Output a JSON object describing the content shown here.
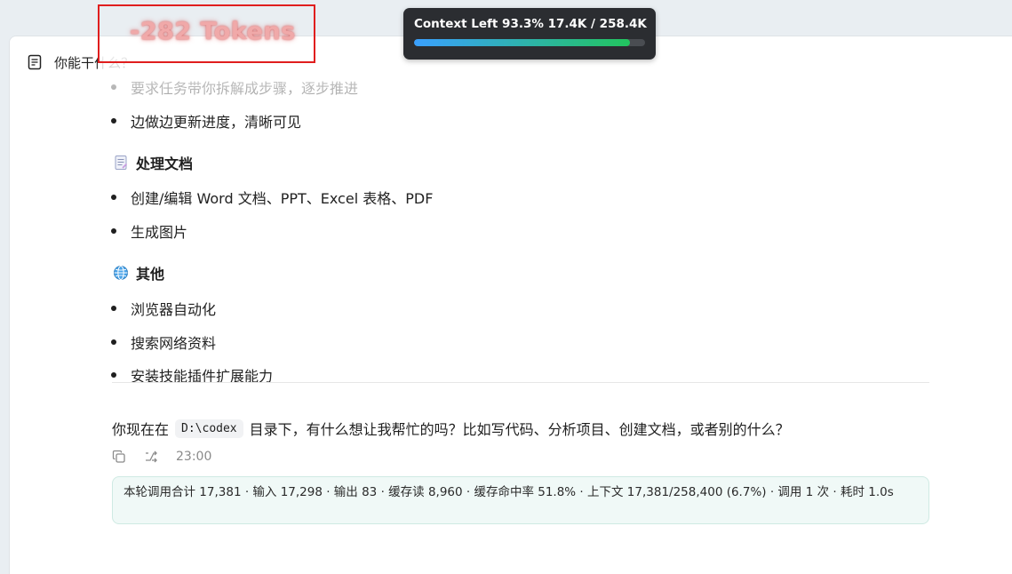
{
  "header": {
    "title": "你能干什么？"
  },
  "content": {
    "faded_item": "要求任务带你拆解成步骤，逐步推进",
    "item_progress": "边做边更新进度，清晰可见",
    "section_docs": "处理文档",
    "docs_items": [
      "创建/编辑 Word 文档、PPT、Excel 表格、PDF",
      "生成图片"
    ],
    "section_other": "其他",
    "other_items": [
      "浏览器自动化",
      "搜索网络资料",
      "安装技能插件扩展能力"
    ]
  },
  "reply": {
    "prefix": "你现在在",
    "code": "D:\\codex",
    "suffix": "目录下，有什么想让我帮忙的吗？比如写代码、分析项目、创建文档，或者别的什么？"
  },
  "message_meta": {
    "time": "23:00"
  },
  "usage": {
    "text": "本轮调用合计 17,381 · 输入 17,298 · 输出 83 · 缓存读 8,960 · 缓存命中率 51.8% · 上下文 17,381/258,400 (6.7%) · 调用 1 次 · 耗时 1.0s"
  },
  "context_tooltip": {
    "text": "Context Left 93.3% 17.4K / 258.4K",
    "fraction_left": 0.933
  },
  "token_delta": {
    "text": "-282 Tokens"
  },
  "colors": {
    "bar_start": "#3aa0ff",
    "bar_end": "#22c55e",
    "highlight_border": "#e01e1e"
  }
}
